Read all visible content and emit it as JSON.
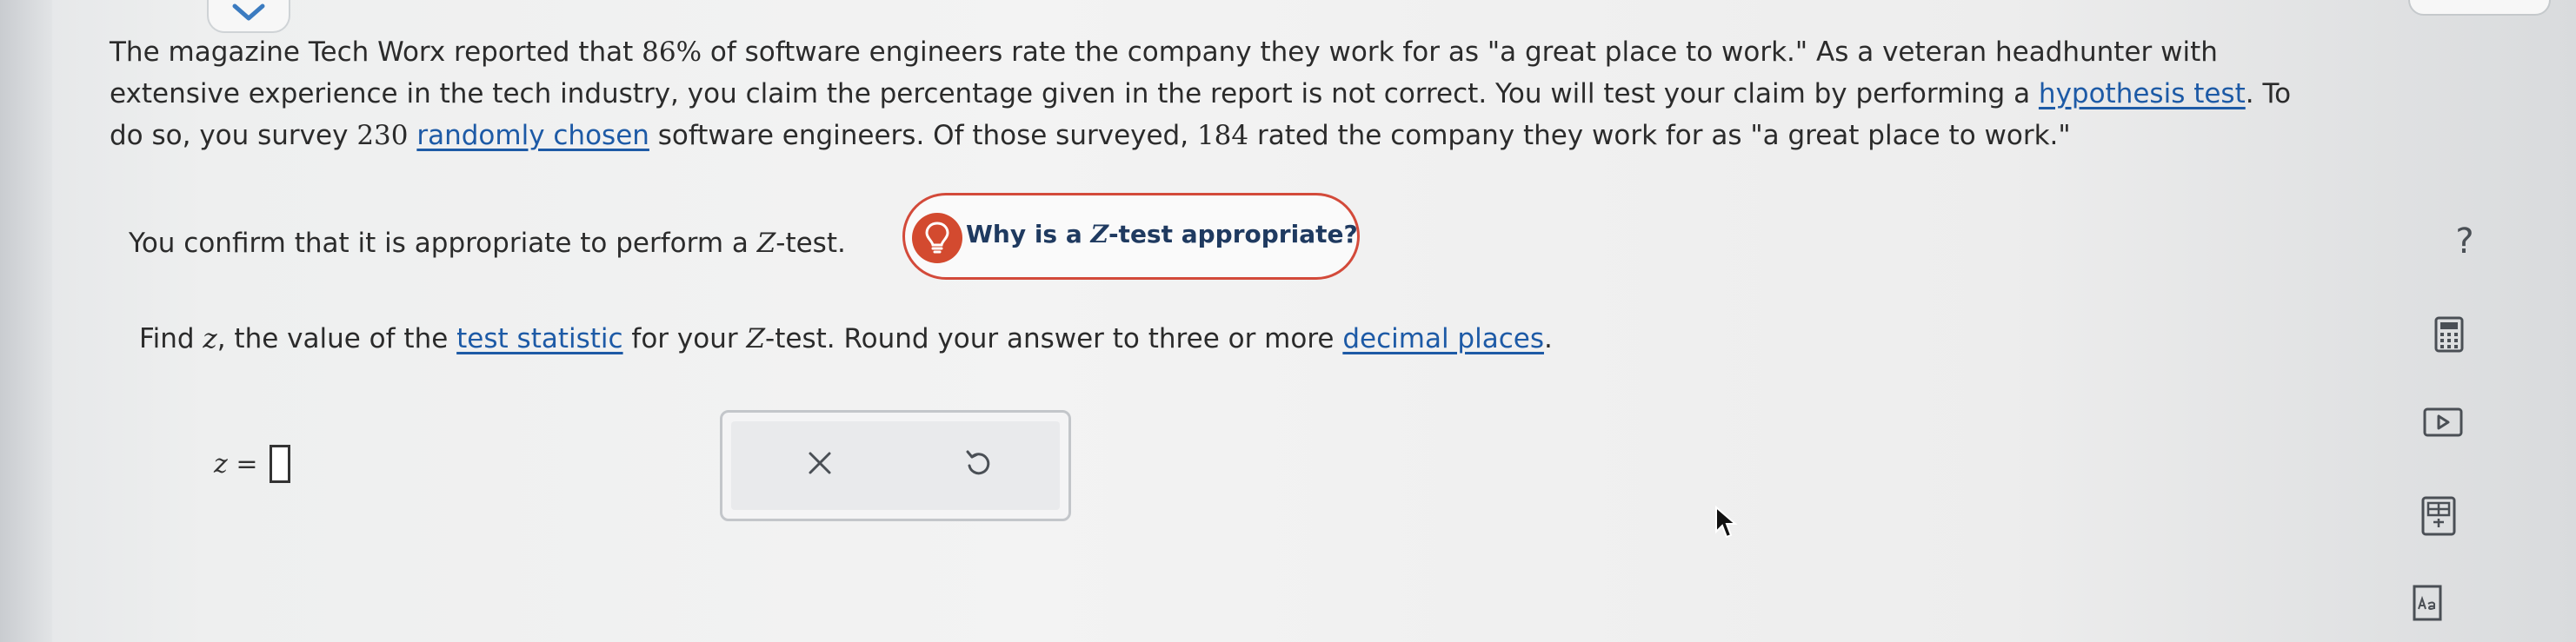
{
  "problem": {
    "line1_pre": "The magazine Tech Worx reported that ",
    "percent": "86%",
    "line1_post": " of software engineers rate the company they work for as \"a great place to work.\" As a veteran headhunter with",
    "line2_pre": "extensive experience in the tech industry, you claim the percentage given in the report is not correct. You will test your claim by performing a ",
    "link_hypothesis_test": "hypothesis test",
    "line2_post": ". To",
    "line3_pre": "do so, you survey ",
    "sample_size": "230",
    "link_randomly_chosen": "randomly chosen",
    "line3_mid": " software engineers. Of those surveyed, ",
    "successes": "184",
    "line3_post": " rated the company they work for as \"a great place to work.\""
  },
  "confirm": {
    "text_pre": "You confirm that it is appropriate to perform a ",
    "z": "Z",
    "text_post": "-test."
  },
  "why_button": {
    "label_pre": "Why is a ",
    "z": "Z",
    "label_post": "-test appropriate?"
  },
  "find": {
    "text_pre": "Find ",
    "z": "z",
    "text_mid1": ", the value of the ",
    "link_test_statistic": "test statistic",
    "text_mid2": " for your ",
    "Z": "Z",
    "text_mid3": "-test. Round your answer to three or more ",
    "link_decimal_places": "decimal places",
    "text_post": "."
  },
  "answer": {
    "label": "z =",
    "value": ""
  },
  "right_rail": {
    "help_label": "?"
  },
  "colors": {
    "link": "#1d5aa6",
    "why_border": "#d34a3a",
    "bulb": "#d34a2f",
    "why_text": "#1f3a60"
  },
  "icons": [
    "chevron-down-icon",
    "lightbulb-icon",
    "close-icon",
    "undo-icon",
    "calculator-icon",
    "video-icon",
    "data-table-icon",
    "glossary-icon",
    "cursor-icon"
  ]
}
